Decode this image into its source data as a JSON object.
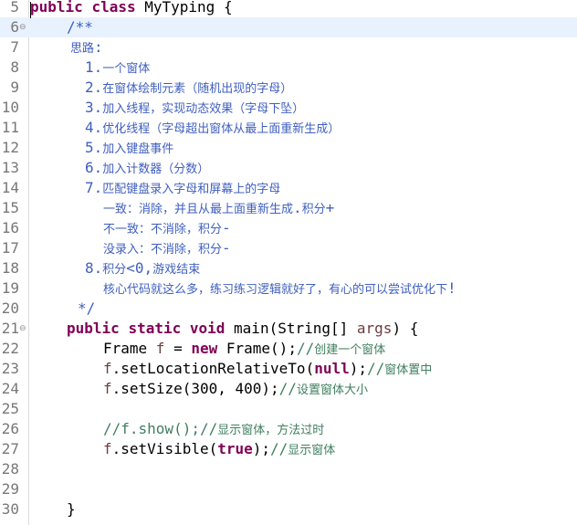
{
  "editor": {
    "language": "java",
    "current_line": 6,
    "colors": {
      "keyword": "#7f0055",
      "javadoc": "#3f5fbf",
      "comment": "#3f7f5f",
      "variable": "#6a3e3e",
      "line_number": "#787878",
      "current_line_bg": "#e8f2fe"
    },
    "fold_icon": "fold-collapse-icon",
    "lines": [
      {
        "n": "5",
        "indent": 0,
        "fold": false,
        "tokens": [
          {
            "t": "kw",
            "v": "public"
          },
          {
            "t": "pl",
            "v": " "
          },
          {
            "t": "kw",
            "v": "class"
          },
          {
            "t": "pl",
            "v": " MyTyping {"
          }
        ]
      },
      {
        "n": "6",
        "indent": 40,
        "fold": true,
        "tokens": [
          {
            "t": "jd",
            "v": "/**"
          }
        ]
      },
      {
        "n": "7",
        "indent": 44,
        "fold": false,
        "tokens": [
          {
            "t": "jd",
            "v": "思路:"
          }
        ]
      },
      {
        "n": "8",
        "indent": 60,
        "fold": false,
        "tokens": [
          {
            "t": "jd",
            "v": "1.一个窗体"
          }
        ]
      },
      {
        "n": "9",
        "indent": 60,
        "fold": false,
        "tokens": [
          {
            "t": "jd",
            "v": "2.在窗体绘制元素（随机出现的字母）"
          }
        ]
      },
      {
        "n": "10",
        "indent": 60,
        "fold": false,
        "tokens": [
          {
            "t": "jd",
            "v": "3.加入线程，实现动态效果（字母下坠）"
          }
        ]
      },
      {
        "n": "11",
        "indent": 60,
        "fold": false,
        "tokens": [
          {
            "t": "jd",
            "v": "4.优化线程（字母超出窗体从最上面重新生成）"
          }
        ]
      },
      {
        "n": "12",
        "indent": 60,
        "fold": false,
        "tokens": [
          {
            "t": "jd",
            "v": "5.加入键盘事件"
          }
        ]
      },
      {
        "n": "13",
        "indent": 60,
        "fold": false,
        "tokens": [
          {
            "t": "jd",
            "v": "6.加入计数器（分数）"
          }
        ]
      },
      {
        "n": "14",
        "indent": 60,
        "fold": false,
        "tokens": [
          {
            "t": "jd",
            "v": "7.匹配键盘录入字母和屏幕上的字母"
          }
        ]
      },
      {
        "n": "15",
        "indent": 80,
        "fold": false,
        "tokens": [
          {
            "t": "jd",
            "v": "一致：消除，并且从最上面重新生成.积分+"
          }
        ]
      },
      {
        "n": "16",
        "indent": 80,
        "fold": false,
        "tokens": [
          {
            "t": "jd",
            "v": "不一致：不消除，积分-"
          }
        ]
      },
      {
        "n": "17",
        "indent": 80,
        "fold": false,
        "tokens": [
          {
            "t": "jd",
            "v": "没录入：不消除，积分-"
          }
        ]
      },
      {
        "n": "18",
        "indent": 60,
        "fold": false,
        "tokens": [
          {
            "t": "jd",
            "v": "8.积分<0,游戏结束"
          }
        ]
      },
      {
        "n": "19",
        "indent": 80,
        "fold": false,
        "tokens": [
          {
            "t": "jd",
            "v": "核心代码就这么多，练习练习逻辑就好了，有心的可以尝试优化下!"
          }
        ]
      },
      {
        "n": "20",
        "indent": 52,
        "fold": false,
        "tokens": [
          {
            "t": "jd",
            "v": "*/"
          }
        ]
      },
      {
        "n": "21",
        "indent": 40,
        "fold": true,
        "tokens": [
          {
            "t": "kw",
            "v": "public"
          },
          {
            "t": "pl",
            "v": " "
          },
          {
            "t": "kw",
            "v": "static"
          },
          {
            "t": "pl",
            "v": " "
          },
          {
            "t": "kw",
            "v": "void"
          },
          {
            "t": "pl",
            "v": " main(String[] "
          },
          {
            "t": "var",
            "v": "args"
          },
          {
            "t": "pl",
            "v": ") {"
          }
        ]
      },
      {
        "n": "22",
        "indent": 80,
        "fold": false,
        "tokens": [
          {
            "t": "pl",
            "v": "Frame "
          },
          {
            "t": "var",
            "v": "f"
          },
          {
            "t": "pl",
            "v": " = "
          },
          {
            "t": "kw",
            "v": "new"
          },
          {
            "t": "pl",
            "v": " Frame();"
          },
          {
            "t": "cm",
            "v": "//创建一个窗体"
          }
        ]
      },
      {
        "n": "23",
        "indent": 80,
        "fold": false,
        "tokens": [
          {
            "t": "var",
            "v": "f"
          },
          {
            "t": "pl",
            "v": ".setLocationRelativeTo("
          },
          {
            "t": "kw",
            "v": "null"
          },
          {
            "t": "pl",
            "v": ");"
          },
          {
            "t": "cm",
            "v": "//窗体置中"
          }
        ]
      },
      {
        "n": "24",
        "indent": 80,
        "fold": false,
        "tokens": [
          {
            "t": "var",
            "v": "f"
          },
          {
            "t": "pl",
            "v": ".setSize(300, 400);"
          },
          {
            "t": "cm",
            "v": "//设置窗体大小"
          }
        ]
      },
      {
        "n": "25",
        "indent": 80,
        "fold": false,
        "tokens": []
      },
      {
        "n": "26",
        "indent": 80,
        "fold": false,
        "tokens": [
          {
            "t": "cm",
            "v": "//f.show();//显示窗体，方法过时"
          }
        ]
      },
      {
        "n": "27",
        "indent": 80,
        "fold": false,
        "tokens": [
          {
            "t": "var",
            "v": "f"
          },
          {
            "t": "pl",
            "v": ".setVisible("
          },
          {
            "t": "kw",
            "v": "true"
          },
          {
            "t": "pl",
            "v": ");"
          },
          {
            "t": "cm",
            "v": "//显示窗体"
          }
        ]
      },
      {
        "n": "28",
        "indent": 80,
        "fold": false,
        "tokens": []
      },
      {
        "n": "29",
        "indent": 80,
        "fold": false,
        "tokens": []
      },
      {
        "n": "30",
        "indent": 40,
        "fold": false,
        "tokens": [
          {
            "t": "pl",
            "v": "}"
          }
        ]
      }
    ]
  }
}
